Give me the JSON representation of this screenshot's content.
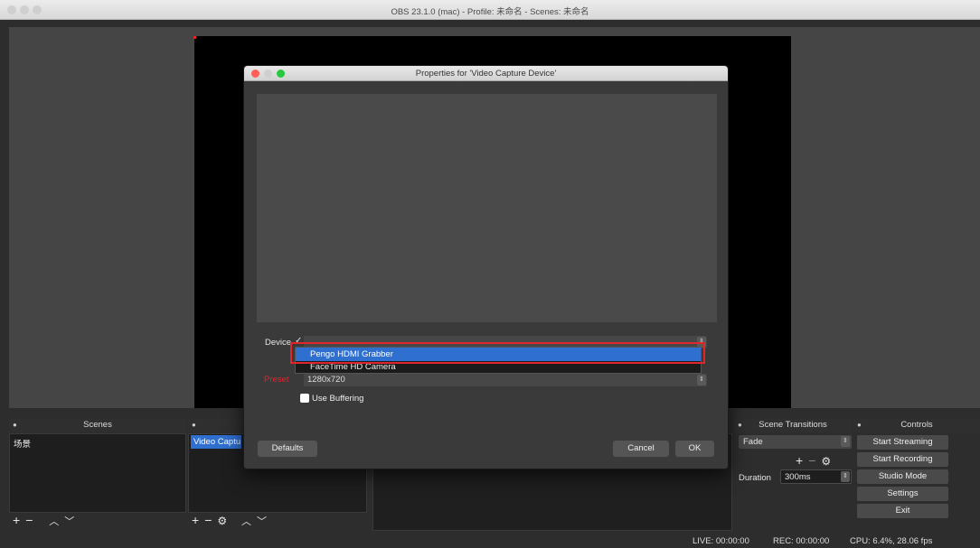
{
  "window": {
    "title": "OBS 23.1.0 (mac) - Profile: 未命名 - Scenes: 未命名"
  },
  "scenes": {
    "title": "Scenes",
    "items": [
      "场景"
    ]
  },
  "sources": {
    "items": [
      "Video Captu"
    ]
  },
  "transitions": {
    "title": "Scene Transitions",
    "selected": "Fade",
    "duration_label": "Duration",
    "duration_value": "300ms"
  },
  "controls": {
    "title": "Controls",
    "buttons": [
      "Start Streaming",
      "Start Recording",
      "Studio Mode",
      "Settings",
      "Exit"
    ]
  },
  "status": {
    "live": "LIVE: 00:00:00",
    "rec": "REC: 00:00:00",
    "cpu": "CPU: 6.4%, 28.06 fps"
  },
  "dialog": {
    "title": "Properties for 'Video Capture Device'",
    "device_label": "Device",
    "device_options": [
      "Pengo HDMI Grabber",
      "FaceTime HD Camera"
    ],
    "preset_label": "Preset",
    "preset_value": "1280x720",
    "use_buffering_label": "Use Buffering",
    "defaults_label": "Defaults",
    "cancel_label": "Cancel",
    "ok_label": "OK"
  },
  "colors": {
    "accent": "#2f6fd0",
    "highlight_border": "#e0252b",
    "close": "#ff5f57",
    "minimize": "#febc2e",
    "zoom": "#28c840"
  }
}
